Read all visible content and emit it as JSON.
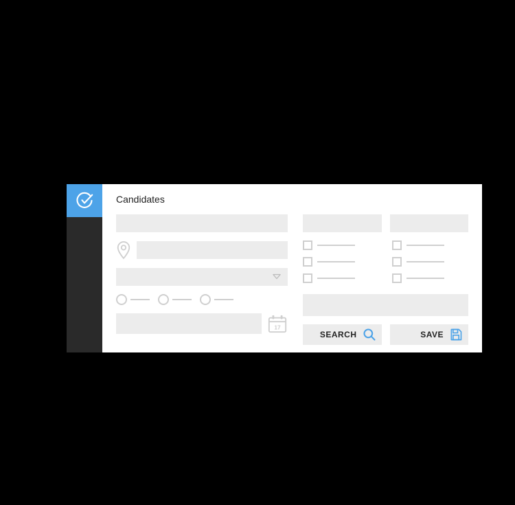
{
  "page": {
    "title": "Candidates"
  },
  "calendar": {
    "day": "17"
  },
  "actions": {
    "search_label": "SEARCH",
    "save_label": "SAVE"
  },
  "colors": {
    "accent": "#4da3e8",
    "sidebar": "#2a2a2a",
    "placeholder": "#ececec",
    "outline": "#cfcfcf"
  }
}
